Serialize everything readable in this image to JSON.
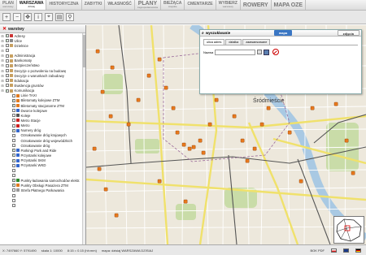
{
  "top_tabs": [
    {
      "line1": "PLAN",
      "line2": "Warszawy"
    },
    {
      "line1": "WARSZAWA",
      "line2": "dzisiaj"
    },
    {
      "line1": "HISTORYCZNA",
      "line2": ""
    },
    {
      "line1": "ZABYTKI",
      "line2": ""
    },
    {
      "line1": "WŁASNOŚĆ",
      "line2": ""
    },
    {
      "line1": "PLANY",
      "line2": "zagospodarowania"
    },
    {
      "line1": "BIEŻĄCA",
      "line2": "miejskie"
    },
    {
      "line1": "CMENTARZE",
      "line2": ""
    },
    {
      "line1": "Wybierz",
      "line2": "Warszawy"
    },
    {
      "line1": "ROWERY",
      "line2": ""
    },
    {
      "line1": "Mapa OZE",
      "line2": ""
    }
  ],
  "sidebar": {
    "title": "warstwy",
    "layers": [
      {
        "label": "Adresy",
        "checked": true,
        "level": 1,
        "icon": "#cc3333"
      },
      {
        "label": "Ulice",
        "checked": true,
        "level": 1,
        "icon": "#888888"
      },
      {
        "label": "Dzielnice",
        "checked": false,
        "level": 1,
        "icon": "#c8a060"
      },
      {
        "label": "",
        "checked": false,
        "level": 1,
        "icon": ""
      },
      {
        "label": "Administracja",
        "checked": false,
        "level": 1,
        "icon": "#c8a060"
      },
      {
        "label": "Bankomaty",
        "checked": false,
        "level": 1,
        "icon": "#c8a060"
      },
      {
        "label": "Bezpieczeństwo",
        "checked": false,
        "level": 1,
        "icon": "#c8a060"
      },
      {
        "label": "Decyzje o pozwoleniu na budowę",
        "checked": false,
        "level": 1,
        "icon": "#c8a060"
      },
      {
        "label": "Decyzje o warunkach zabudowy",
        "checked": false,
        "level": 1,
        "icon": "#c8a060"
      },
      {
        "label": "Edukacja",
        "checked": false,
        "level": 1,
        "icon": "#c8a060"
      },
      {
        "label": "Ewidencja gruntów",
        "checked": false,
        "level": 1,
        "icon": "#c8a060"
      },
      {
        "label": "Komunikacja",
        "checked": true,
        "level": 1,
        "icon": "#c8a060"
      },
      {
        "label": "Linie TAXI",
        "checked": false,
        "level": 2,
        "icon": "#e07a20"
      },
      {
        "label": "Biletomaty kolejowe ZTM",
        "checked": true,
        "level": 2,
        "icon": "#e07a20"
      },
      {
        "label": "Biletomaty stacjonarne ZTM",
        "checked": true,
        "level": 2,
        "icon": "#e07a20"
      },
      {
        "label": "Dworce kolejowe",
        "checked": false,
        "level": 2,
        "icon": "#3366cc"
      },
      {
        "label": "Koleje",
        "checked": false,
        "level": 2,
        "icon": "#555555"
      },
      {
        "label": "Metro Stacje",
        "checked": false,
        "level": 2,
        "icon": "#cc2222"
      },
      {
        "label": "Metro",
        "checked": false,
        "level": 2,
        "icon": "#cc2222"
      },
      {
        "label": "Numery dróg",
        "checked": true,
        "level": 2,
        "icon": "#3366cc"
      },
      {
        "label": "Oznakowanie dróg krajowych",
        "checked": false,
        "level": 2,
        "icon": ""
      },
      {
        "label": "Oznakowanie dróg wojewódzkich",
        "checked": false,
        "level": 2,
        "icon": ""
      },
      {
        "label": "Oznakowanie dróg",
        "checked": false,
        "level": 2,
        "icon": ""
      },
      {
        "label": "Parkingi Park and Ride",
        "checked": true,
        "level": 2,
        "icon": "#3366cc"
      },
      {
        "label": "Przystanki kolejowe",
        "checked": true,
        "level": 2,
        "icon": "#3366cc"
      },
      {
        "label": "Przystanki SKM",
        "checked": true,
        "level": 2,
        "icon": "#3366cc"
      },
      {
        "label": "Przystanki WKD",
        "checked": false,
        "level": 2,
        "icon": "#3366cc"
      },
      {
        "label": "",
        "checked": false,
        "level": 2,
        "icon": ""
      },
      {
        "label": "",
        "checked": false,
        "level": 2,
        "icon": ""
      },
      {
        "label": "Punkty ładowania samochodów elektr.",
        "checked": true,
        "level": 2,
        "icon": "#2a8a2a"
      },
      {
        "label": "Punkty Obsługi Pasażera ZTM",
        "checked": true,
        "level": 2,
        "icon": "#e07a20"
      },
      {
        "label": "Strefa Płatnego Parkowania",
        "checked": false,
        "level": 2,
        "icon": "#999999"
      },
      {
        "label": "",
        "checked": false,
        "level": 2,
        "icon": ""
      },
      {
        "label": "",
        "checked": false,
        "level": 2,
        "icon": ""
      },
      {
        "label": "",
        "checked": false,
        "level": 2,
        "icon": ""
      }
    ]
  },
  "search_panel": {
    "title": "wyszukiwanie",
    "head_tab_active": "mapa",
    "head_tab_other": "zdjęcia",
    "tabs": [
      "ulica adres",
      "działka",
      "zaawansowane"
    ],
    "field_label": "Nazwa"
  },
  "map": {
    "district_label": "Śródmieście",
    "colors": {
      "water": "#a9c9e3",
      "park": "#c9dca8",
      "road_main": "#f0e16b",
      "marker": "#e8791e",
      "rail": "#666666"
    },
    "map_icons": [
      "ztm-marker-icon",
      "ztm-marker-icon",
      "ztm-marker-icon",
      "ztm-marker-icon",
      "ztm-marker-icon",
      "ztm-marker-icon",
      "ztm-marker-icon",
      "ztm-marker-icon",
      "ztm-marker-icon",
      "ztm-marker-icon",
      "ztm-marker-icon",
      "ztm-marker-icon",
      "ztm-marker-icon",
      "ztm-marker-icon",
      "ztm-marker-icon",
      "ztm-marker-icon",
      "ztm-marker-icon",
      "ztm-marker-icon",
      "ztm-marker-icon",
      "ztm-marker-icon",
      "ztm-marker-icon",
      "ztm-marker-icon",
      "ztm-marker-icon",
      "ztm-marker-icon",
      "ztm-marker-icon",
      "ztm-marker-icon",
      "ztm-marker-icon",
      "ztm-marker-icon",
      "ztm-marker-icon",
      "ztm-marker-icon",
      "ztm-marker-icon",
      "ztm-marker-icon",
      "ztm-marker-icon",
      "ztm-marker-icon",
      "ztm-marker-icon",
      "ztm-marker-icon",
      "ztm-marker-icon",
      "ztm-marker-icon",
      "ztm-marker-icon",
      "ztm-marker-icon"
    ]
  },
  "statusbar": {
    "coords": "X: 7497660 Y: 5791490",
    "scale": "skala 1: 10000",
    "time": "8:15 = 0.15 (hh:mm)",
    "system": "układ: współrzędnych",
    "source": "mapa: dzisiaj WARSZAWA DZISIAJ",
    "right": "BOK PDF"
  }
}
